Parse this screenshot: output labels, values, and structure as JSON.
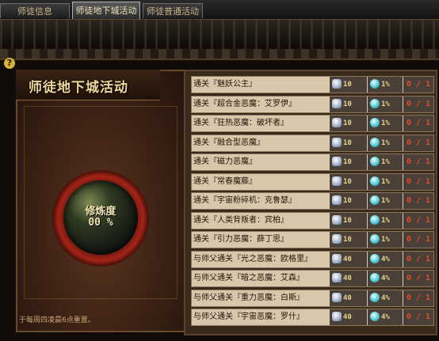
{
  "tabs": [
    {
      "label": "师徒信息",
      "active": false
    },
    {
      "label": "师徒地下城活动",
      "active": true
    },
    {
      "label": "师徒普通活动",
      "active": false
    }
  ],
  "page": {
    "title": "师徒地下城活动",
    "help_glyph": "?"
  },
  "orb": {
    "label": "修炼度",
    "value": "00 %"
  },
  "reset_note": "于每周四凌晨6点重置。",
  "quests": [
    {
      "name": "通关『魅妖公主』",
      "token": "10",
      "gem": "1%",
      "progress": "0 / 1"
    },
    {
      "name": "通关『超合金恶魔：艾罗伊』",
      "token": "10",
      "gem": "1%",
      "progress": "0 / 1"
    },
    {
      "name": "通关『狂热恶魔：破坏者』",
      "token": "10",
      "gem": "1%",
      "progress": "0 / 1"
    },
    {
      "name": "通关『融合型恶魔』",
      "token": "10",
      "gem": "1%",
      "progress": "0 / 1"
    },
    {
      "name": "通关『磁力恶魔』",
      "token": "10",
      "gem": "1%",
      "progress": "0 / 1"
    },
    {
      "name": "通关『常春魔藤』",
      "token": "10",
      "gem": "1%",
      "progress": "0 / 1"
    },
    {
      "name": "通关『宇宙粉碎机：克鲁瑟』",
      "token": "10",
      "gem": "1%",
      "progress": "0 / 1"
    },
    {
      "name": "通关『人类背叛者：宾柏』",
      "token": "10",
      "gem": "1%",
      "progress": "0 / 1"
    },
    {
      "name": "通关『引力恶魔：薛丁思』",
      "token": "10",
      "gem": "1%",
      "progress": "0 / 1"
    },
    {
      "name": "与师父通关『光之恶魔：欧格里』",
      "token": "40",
      "gem": "4%",
      "progress": "0 / 1"
    },
    {
      "name": "与师父通关『暗之恶魔：艾森』",
      "token": "40",
      "gem": "4%",
      "progress": "0 / 1"
    },
    {
      "name": "与师父通关『重力恶魔：白斯』",
      "token": "40",
      "gem": "4%",
      "progress": "0 / 1"
    },
    {
      "name": "与师父通关『宇宙恶魔：罗什』",
      "token": "40",
      "gem": "4%",
      "progress": "0 / 1"
    }
  ],
  "colors": {
    "accent_gold": "#f0d79a",
    "progress_red": "#e44a2c",
    "row_bg": "#d8c7ab"
  },
  "icons": {
    "reward_token": "token-icon",
    "reward_gem": "gem-icon",
    "help": "help-icon"
  }
}
